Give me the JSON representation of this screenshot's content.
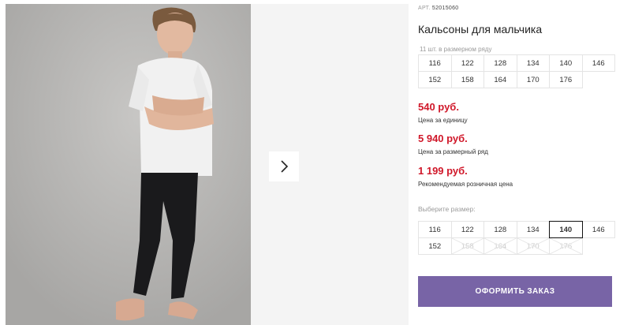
{
  "product": {
    "sku_label": "АРТ.",
    "sku": "52015060",
    "title": "Кальсоны для мальчика"
  },
  "assortment": {
    "note": "11 шт. в размерном ряду",
    "sizes": [
      "116",
      "122",
      "128",
      "134",
      "140",
      "146",
      "152",
      "158",
      "164",
      "170",
      "176"
    ]
  },
  "prices": {
    "unit_price": "540 руб.",
    "unit_price_label": "Цена за единицу",
    "set_price": "5 940 руб.",
    "set_price_label": "Цена за размерный ряд",
    "retail_price": "1 199 руб.",
    "retail_price_label": "Рекомендуемая розничная цена"
  },
  "size_select": {
    "label": "Выберите размер:",
    "sizes": [
      {
        "value": "116",
        "state": "available"
      },
      {
        "value": "122",
        "state": "available"
      },
      {
        "value": "128",
        "state": "available"
      },
      {
        "value": "134",
        "state": "available"
      },
      {
        "value": "140",
        "state": "selected"
      },
      {
        "value": "146",
        "state": "available"
      },
      {
        "value": "152",
        "state": "available"
      },
      {
        "value": "158",
        "state": "disabled"
      },
      {
        "value": "164",
        "state": "disabled"
      },
      {
        "value": "170",
        "state": "disabled"
      },
      {
        "value": "176",
        "state": "disabled"
      }
    ]
  },
  "order_button": {
    "label": "ОФОРМИТЬ ЗАКАЗ",
    "color": "#7864a6"
  },
  "gallery": {
    "next_icon": "chevron-right-icon"
  },
  "colors": {
    "price": "#d0182a",
    "accent": "#7864a6"
  }
}
